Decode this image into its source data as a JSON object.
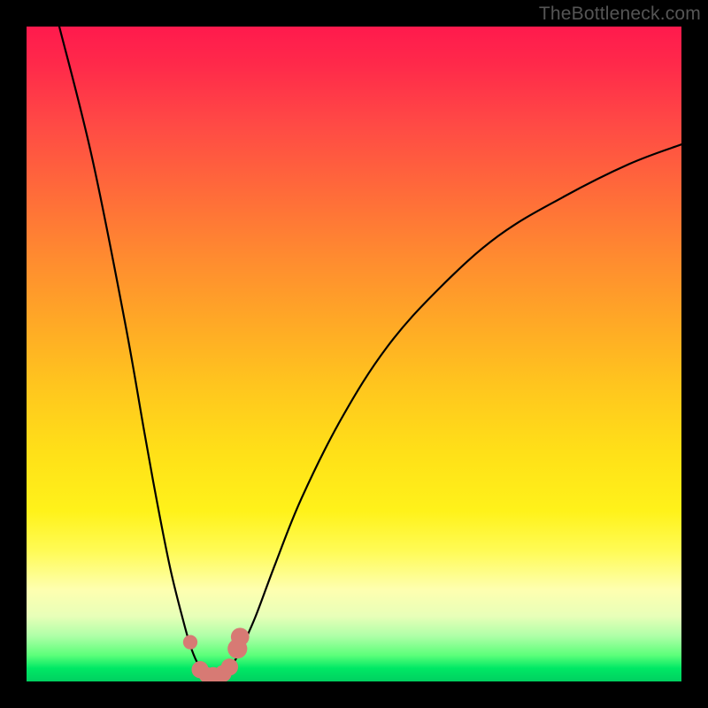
{
  "watermark": "TheBottleneck.com",
  "colors": {
    "frame": "#000000",
    "curve": "#000000",
    "marker_fill": "#d77a74",
    "gradient_top": "#ff1a4d",
    "gradient_bottom": "#00d060"
  },
  "chart_data": {
    "type": "line",
    "title": "",
    "xlabel": "",
    "ylabel": "",
    "xlim": [
      0,
      100
    ],
    "ylim": [
      0,
      100
    ],
    "grid": false,
    "legend": false,
    "description": "V-shaped bottleneck curve over rainbow gradient; y roughly represents bottleneck % (100 = worst, 0 = best). Minimum near x≈28.",
    "series": [
      {
        "name": "bottleneck-curve",
        "x": [
          5,
          10,
          15,
          18,
          20,
          22,
          24,
          25,
          26,
          27,
          28,
          29,
          30,
          31,
          32,
          33,
          35,
          38,
          42,
          48,
          55,
          63,
          72,
          82,
          92,
          100
        ],
        "y": [
          100,
          80,
          55,
          38,
          27,
          17,
          9,
          5.5,
          3,
          1.5,
          0.8,
          0.8,
          1.2,
          2,
          3.5,
          5.5,
          10,
          18,
          28,
          40,
          51,
          60,
          68,
          74,
          79,
          82
        ]
      }
    ],
    "markers": [
      {
        "x": 25.0,
        "y": 6.0,
        "r": 1.1
      },
      {
        "x": 26.5,
        "y": 1.8,
        "r": 1.3
      },
      {
        "x": 27.5,
        "y": 1.0,
        "r": 1.2
      },
      {
        "x": 28.5,
        "y": 0.9,
        "r": 1.3
      },
      {
        "x": 30.0,
        "y": 1.2,
        "r": 1.3
      },
      {
        "x": 31.0,
        "y": 2.2,
        "r": 1.3
      },
      {
        "x": 32.2,
        "y": 5.0,
        "r": 1.5
      },
      {
        "x": 32.6,
        "y": 6.8,
        "r": 1.4
      }
    ]
  }
}
